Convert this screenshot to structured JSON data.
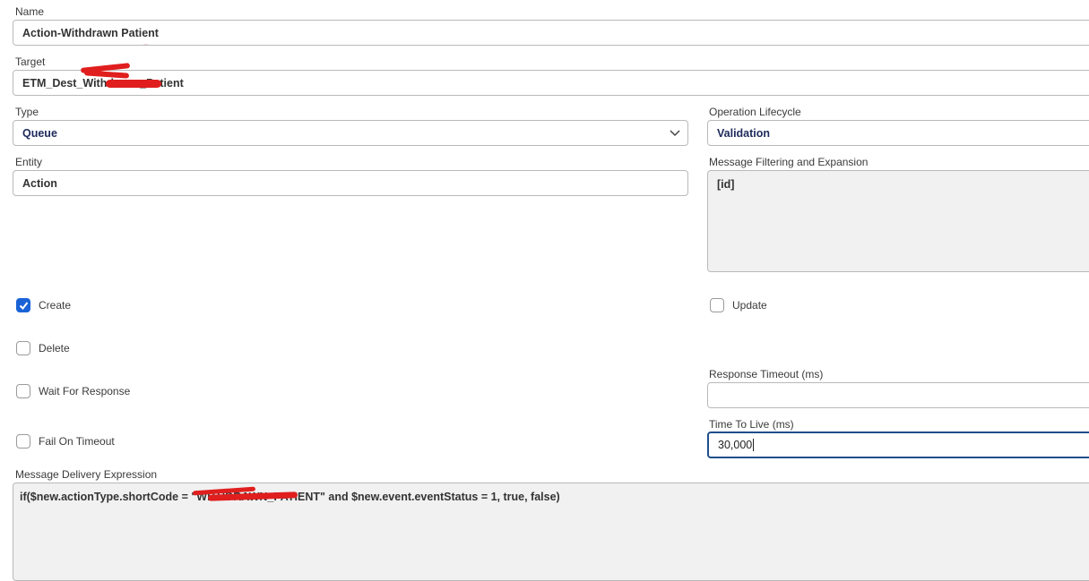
{
  "form": {
    "name": {
      "label": "Name",
      "value": "Action-Withdrawn Patient"
    },
    "target": {
      "label": "Target",
      "value": "ETM_Dest_Withdrawn_Patient"
    },
    "type": {
      "label": "Type",
      "value": "Queue"
    },
    "operation_lifecycle": {
      "label": "Operation Lifecycle",
      "value": "Validation"
    },
    "entity": {
      "label": "Entity",
      "value": "Action"
    },
    "message_filtering": {
      "label": "Message Filtering and Expansion",
      "value": "[id]"
    },
    "checkboxes": {
      "create": {
        "label": "Create",
        "checked": true
      },
      "update": {
        "label": "Update",
        "checked": false
      },
      "delete": {
        "label": "Delete",
        "checked": false
      },
      "wait_for_response": {
        "label": "Wait For Response",
        "checked": false
      },
      "fail_on_timeout": {
        "label": "Fail On Timeout",
        "checked": false
      }
    },
    "response_timeout": {
      "label": "Response Timeout (ms)",
      "value": ""
    },
    "time_to_live": {
      "label": "Time To Live (ms)",
      "value": "30,000"
    },
    "message_delivery": {
      "label": "Message Delivery Expression",
      "value": "if($new.actionType.shortCode = \"WITHDRAWN_PATIENT\" and $new.event.eventStatus = 1, true, false)"
    }
  },
  "colors": {
    "checkbox_checked": "#1a63d6",
    "focus_border": "#1f4e8c",
    "select_text": "#1d2a5b",
    "redaction": "#e01e1e"
  }
}
